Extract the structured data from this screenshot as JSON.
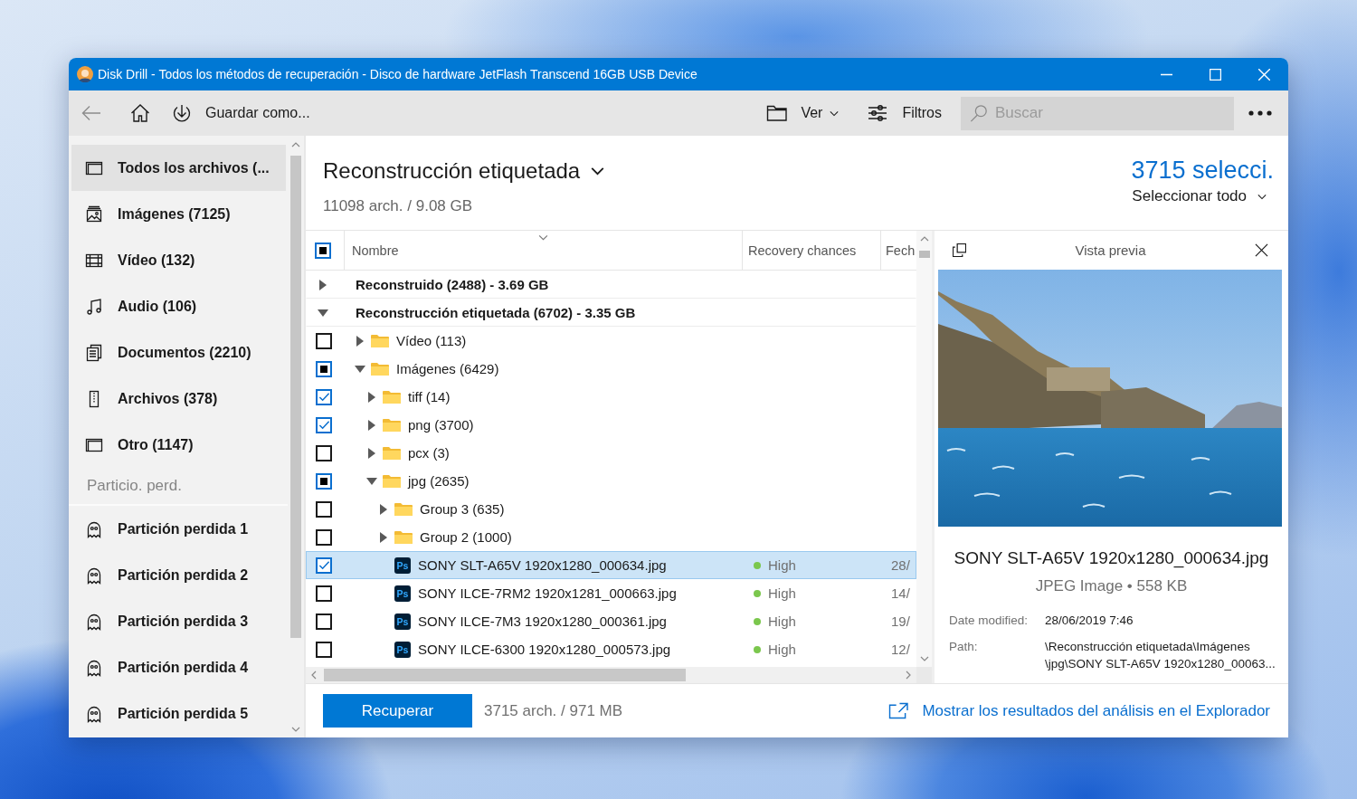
{
  "window": {
    "title": "Disk Drill - Todos los métodos de recuperación - Disco de hardware JetFlash Transcend 16GB USB Device"
  },
  "toolbar": {
    "back": {
      "disabled": true
    },
    "save_label": "Guardar como...",
    "view_label": "Ver",
    "filters_label": "Filtros",
    "search": {
      "placeholder": "Buscar"
    }
  },
  "sidebar": {
    "items": [
      {
        "kind": "all",
        "label": "Todos los archivos (...",
        "selected": true
      },
      {
        "kind": "images",
        "label": "Imágenes (7125)",
        "selected": false
      },
      {
        "kind": "video",
        "label": "Vídeo (132)",
        "selected": false
      },
      {
        "kind": "audio",
        "label": "Audio (106)",
        "selected": false
      },
      {
        "kind": "documents",
        "label": "Documentos (2210)",
        "selected": false
      },
      {
        "kind": "archives",
        "label": "Archivos (378)",
        "selected": false
      },
      {
        "kind": "other",
        "label": "Otro (1147)",
        "selected": false
      }
    ],
    "section_label": "Particio. perd.",
    "partitions": [
      {
        "label": "Partición perdida 1",
        "selected": false
      },
      {
        "label": "Partición perdida 2",
        "selected": false
      },
      {
        "label": "Partición perdida 3",
        "selected": false
      },
      {
        "label": "Partición perdida 4",
        "selected": false
      },
      {
        "label": "Partición perdida 5",
        "selected": false
      }
    ]
  },
  "results": {
    "title": "Reconstrucción etiquetada",
    "summary": "11098 arch. / 9.08 GB",
    "selection_count": "3715 selecci.",
    "select_all_label": "Seleccionar todo"
  },
  "table": {
    "header_checkbox": {
      "checked": true,
      "partial": true
    },
    "columns": [
      "Nombre",
      "Recovery chances",
      "Fech"
    ],
    "rows": [
      {
        "kind": "group",
        "name": "Reconstruido (2488) - 3.69 GB",
        "expanded": false,
        "selected": false
      },
      {
        "kind": "group",
        "name": "Reconstrucción etiquetada (6702) - 3.35 GB",
        "expanded": true,
        "selected": false,
        "children": [
          {
            "kind": "folder",
            "name": "Vídeo (113)",
            "expanded": false,
            "checked": false,
            "partial": false,
            "selected": false
          },
          {
            "kind": "folder",
            "name": "Imágenes (6429)",
            "expanded": true,
            "checked": true,
            "partial": true,
            "selected": false,
            "children": [
              {
                "kind": "folder",
                "name": "tiff (14)",
                "expanded": false,
                "checked": true,
                "partial": false,
                "selected": false
              },
              {
                "kind": "folder",
                "name": "png (3700)",
                "expanded": false,
                "checked": true,
                "partial": false,
                "selected": false
              },
              {
                "kind": "folder",
                "name": "pcx (3)",
                "expanded": false,
                "checked": false,
                "partial": false,
                "selected": false
              },
              {
                "kind": "folder",
                "name": "jpg (2635)",
                "expanded": true,
                "checked": true,
                "partial": true,
                "selected": false,
                "children": [
                  {
                    "kind": "folder",
                    "name": "Group 3 (635)",
                    "expanded": false,
                    "checked": false,
                    "partial": false,
                    "selected": false
                  },
                  {
                    "kind": "folder",
                    "name": "Group 2 (1000)",
                    "expanded": false,
                    "checked": false,
                    "partial": false,
                    "selected": false
                  },
                  {
                    "kind": "file",
                    "badge": "Ps",
                    "name": "SONY SLT-A65V 1920x1280_000634.jpg",
                    "checked": true,
                    "partial": false,
                    "selected": true,
                    "chance": "High",
                    "color": "#7bc74d",
                    "date": "28/"
                  },
                  {
                    "kind": "file",
                    "badge": "Ps",
                    "name": "SONY ILCE-7RM2 1920x1281_000663.jpg",
                    "checked": false,
                    "partial": false,
                    "selected": false,
                    "chance": "High",
                    "color": "#7bc74d",
                    "date": "14/"
                  },
                  {
                    "kind": "file",
                    "badge": "Ps",
                    "name": "SONY ILCE-7M3 1920x1280_000361.jpg",
                    "checked": false,
                    "partial": false,
                    "selected": false,
                    "chance": "High",
                    "color": "#7bc74d",
                    "date": "19/"
                  },
                  {
                    "kind": "file",
                    "badge": "Ps",
                    "name": "SONY ILCE-6300 1920x1280_000573.jpg",
                    "checked": false,
                    "partial": false,
                    "selected": false,
                    "chance": "High",
                    "color": "#7bc74d",
                    "date": "12/"
                  }
                ]
              }
            ]
          }
        ]
      }
    ]
  },
  "preview": {
    "title": "Vista previa",
    "file_name": "SONY SLT-A65V 1920x1280_000634.jpg",
    "file_info": "JPEG Image • 558 KB",
    "details": [
      {
        "label": "Date modified:",
        "lines": [
          "28/06/2019 7:46"
        ]
      },
      {
        "label": "Path:",
        "lines": [
          "\\Reconstrucción etiquetada\\Imágenes",
          "\\jpg\\SONY SLT-A65V 1920x1280_00063..."
        ]
      }
    ]
  },
  "footer": {
    "recover_label": "Recuperar",
    "summary": "3715 arch. / 971 MB",
    "explorer_link": "Mostrar los resultados del análisis en el Explorador"
  }
}
